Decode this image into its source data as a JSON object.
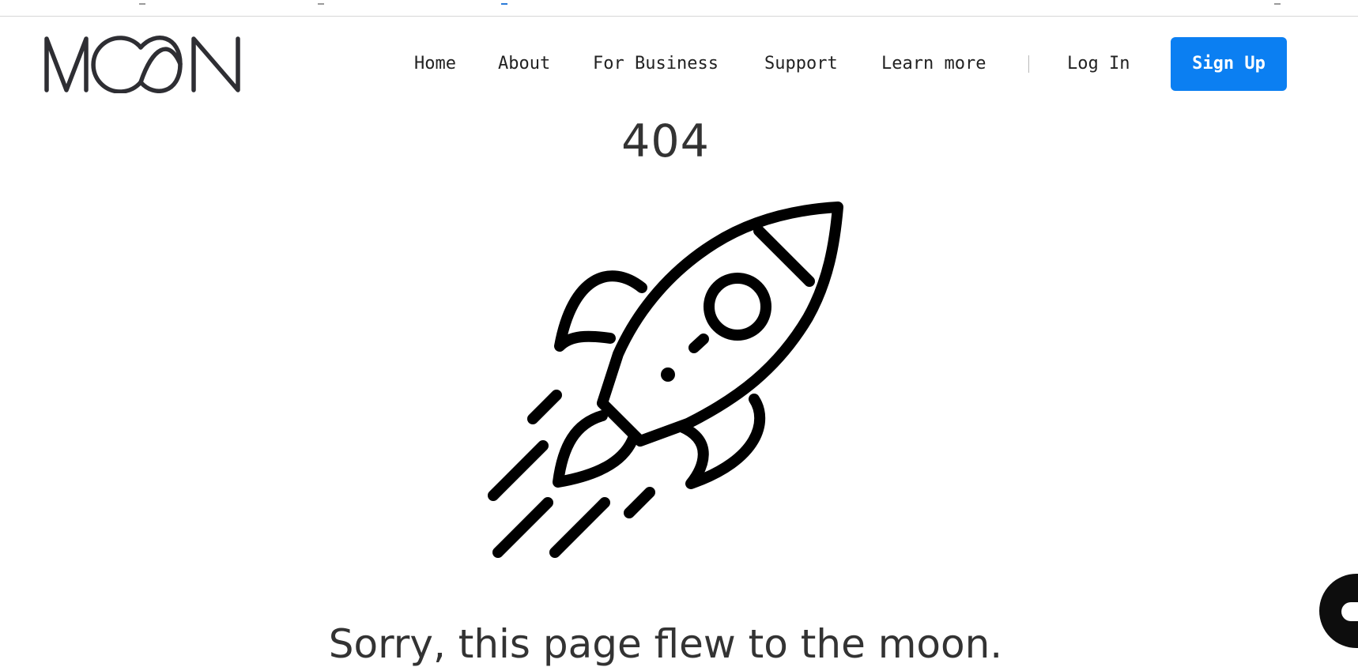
{
  "brand": {
    "logo_text": "MOON"
  },
  "nav": {
    "items": [
      {
        "label": "Home"
      },
      {
        "label": "About"
      },
      {
        "label": "For Business"
      },
      {
        "label": "Support"
      },
      {
        "label": "Learn more"
      }
    ],
    "login_label": "Log In",
    "signup_label": "Sign Up"
  },
  "error": {
    "code": "404",
    "message": "Sorry, this page flew to the moon."
  },
  "icons": {
    "illustration": "rocket-icon",
    "chat": "chat-icon"
  },
  "colors": {
    "accent": "#0b7ff2",
    "text": "#222222",
    "icon_stroke": "#000000"
  }
}
